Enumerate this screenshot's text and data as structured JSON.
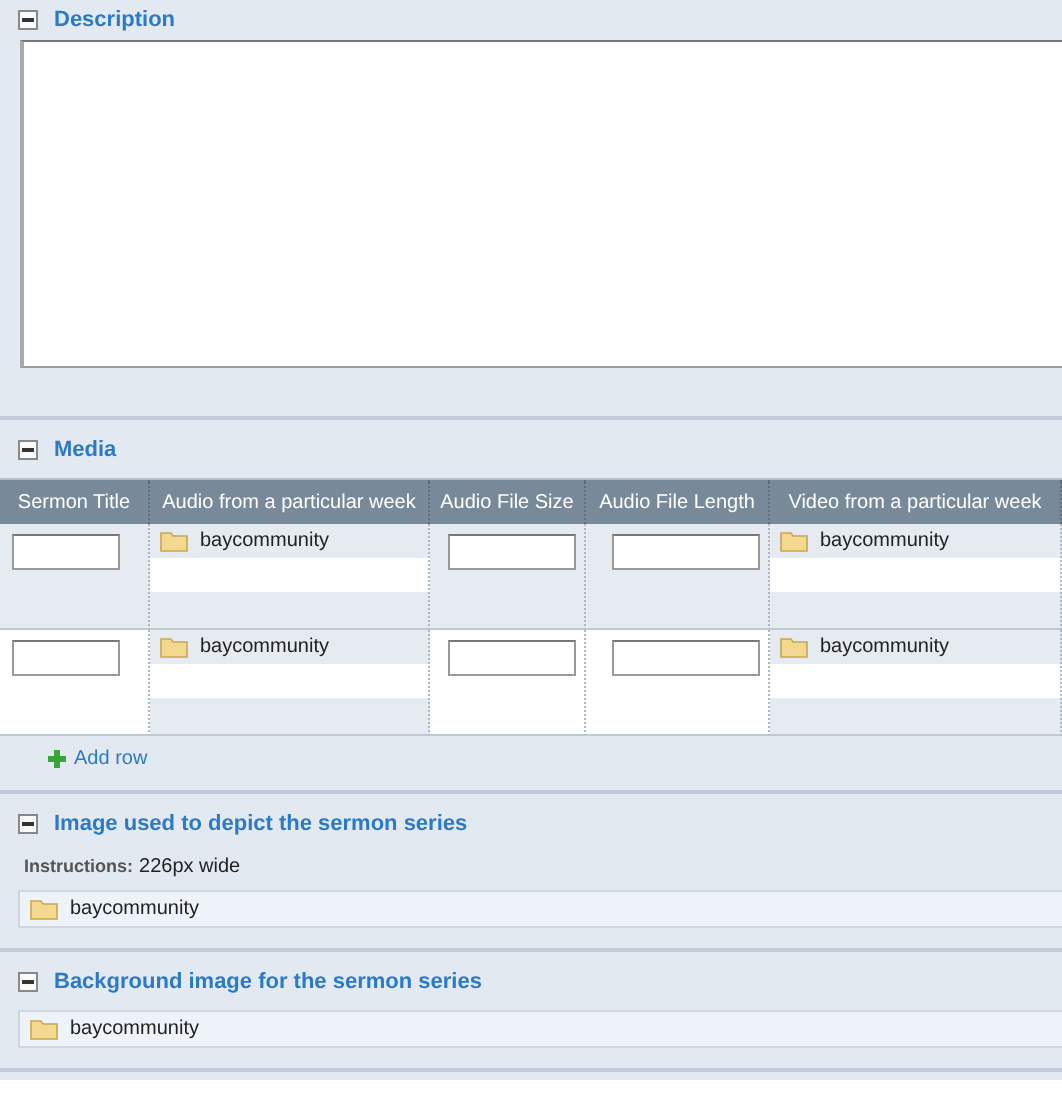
{
  "sections": [
    {
      "kind": "textarea",
      "title": "Description",
      "expanded": true
    },
    {
      "kind": "table",
      "title": "Media",
      "expanded": true,
      "columns": [
        "Sermon Title",
        "Audio from a particular week",
        "Audio File Size",
        "Audio File Length",
        "Video from a particular week"
      ],
      "rows": [
        {
          "audio": "baycommunity",
          "video": "baycommunity"
        },
        {
          "audio": "baycommunity",
          "video": "baycommunity"
        }
      ],
      "add_row": "Add row"
    },
    {
      "kind": "folder",
      "title": "Image used to depict the sermon series",
      "expanded": true,
      "instructions_label": "Instructions:",
      "instructions": "226px wide",
      "folder": "baycommunity"
    },
    {
      "kind": "folder",
      "title": "Background image for the sermon series",
      "expanded": true,
      "folder": "baycommunity"
    }
  ]
}
